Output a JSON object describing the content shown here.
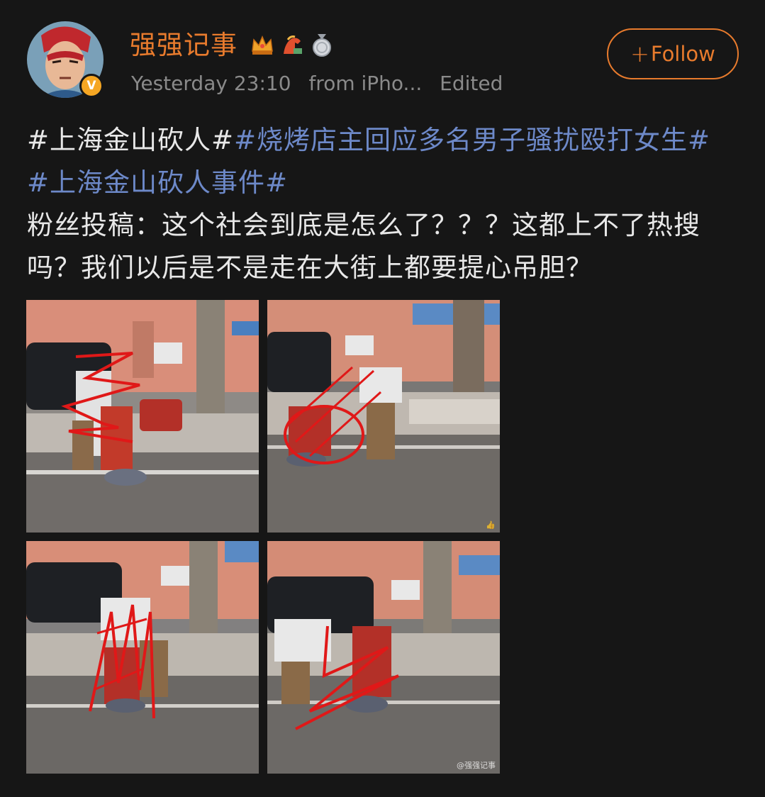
{
  "post": {
    "username": "强强记事",
    "timestamp": "Yesterday 23:10",
    "source": "from iPho...",
    "edited": "Edited",
    "follow_label": "Follow",
    "follow_icon": "plus-icon",
    "badges": [
      "crown-badge-icon",
      "horse-badge-icon",
      "medal-badge-icon"
    ],
    "verified_mark": "V",
    "accent_color": "#e87b2d",
    "link_color": "#6d89c9",
    "hashtags": [
      "#上海金山砍人#",
      "#烧烤店主回应多名男子骚扰殴打女生#",
      "#上海金山砍人事件#"
    ],
    "body_text": "粉丝投稿：这个社会到底是怎么了？？？这都上不了热搜吗？我们以后是不是走在大街上都要提心吊胆？",
    "watermark": "@强强记事"
  }
}
